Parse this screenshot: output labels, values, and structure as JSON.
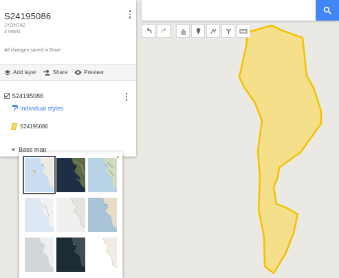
{
  "map": {
    "title": "S24195086",
    "description": "JYON7A2",
    "views": "3 views",
    "saved_status": "All changes saved in Drive"
  },
  "actions": {
    "add_layer": "Add layer",
    "share": "Share",
    "preview": "Preview"
  },
  "layer": {
    "name": "S24195086",
    "style_link": "Individual styles",
    "feature_name": "S24195086",
    "feature_color": "#f5d76e"
  },
  "basemap": {
    "label": "Base map",
    "close": "×",
    "styles": [
      {
        "name": "map",
        "selected": true
      },
      {
        "name": "satellite",
        "selected": false
      },
      {
        "name": "terrain",
        "selected": false
      },
      {
        "name": "light-political",
        "selected": false
      },
      {
        "name": "mono-city",
        "selected": false
      },
      {
        "name": "simple-atlas",
        "selected": false
      },
      {
        "name": "light-landmass",
        "selected": false
      },
      {
        "name": "dark-landmass",
        "selected": false
      },
      {
        "name": "whitewater",
        "selected": false
      }
    ]
  },
  "search": {
    "placeholder": "",
    "value": ""
  },
  "toolbar": {
    "tools": [
      "undo-icon",
      "redo-icon",
      "hand-icon",
      "marker-icon",
      "draw-line-icon",
      "route-icon",
      "ruler-icon"
    ]
  },
  "colors": {
    "accent": "#4285f4",
    "polygon_fill": "#f5df8a",
    "polygon_stroke": "#f1c200",
    "map_background": "#ebe9e4"
  }
}
